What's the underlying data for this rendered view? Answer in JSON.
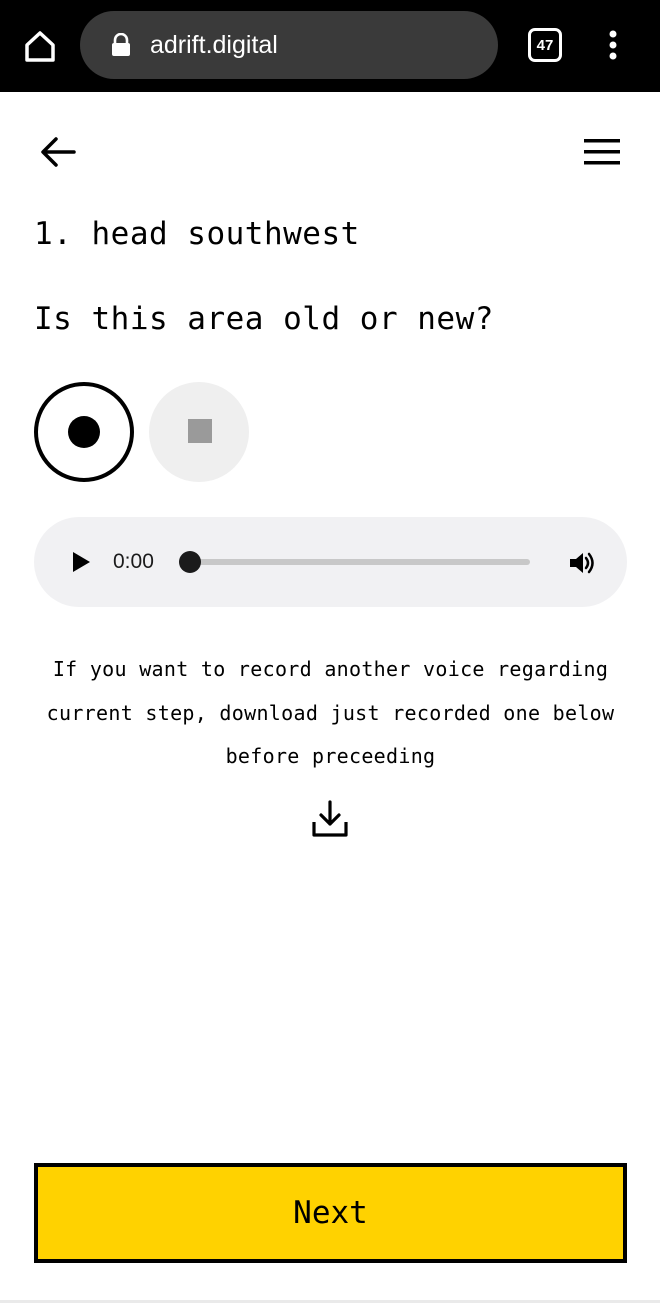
{
  "browser": {
    "url": "adrift.digital",
    "tab_count": "47",
    "home_icon": "home-icon",
    "lock_icon": "lock-icon",
    "menu_icon": "kebab-menu-icon"
  },
  "header": {
    "back_icon": "arrow-left-icon",
    "menu_icon": "hamburger-menu-icon"
  },
  "step": {
    "title": "1. head southwest",
    "question": "Is this area old or new?"
  },
  "recorder": {
    "record_icon": "record-icon",
    "stop_icon": "stop-icon",
    "recording": false
  },
  "audio": {
    "time": "0:00",
    "progress": 0,
    "play_icon": "play-icon",
    "volume_icon": "volume-icon"
  },
  "info": {
    "text": "If you want to record another voice regarding current step, download just recorded one below before preceeding",
    "download_icon": "download-icon"
  },
  "actions": {
    "next_label": "Next"
  },
  "colors": {
    "browser_bar": "#000000",
    "url_pill": "#3a3a3a",
    "accent_yellow": "#ffd200",
    "audio_bg": "#f1f1f3",
    "stop_bg": "#efefef"
  }
}
